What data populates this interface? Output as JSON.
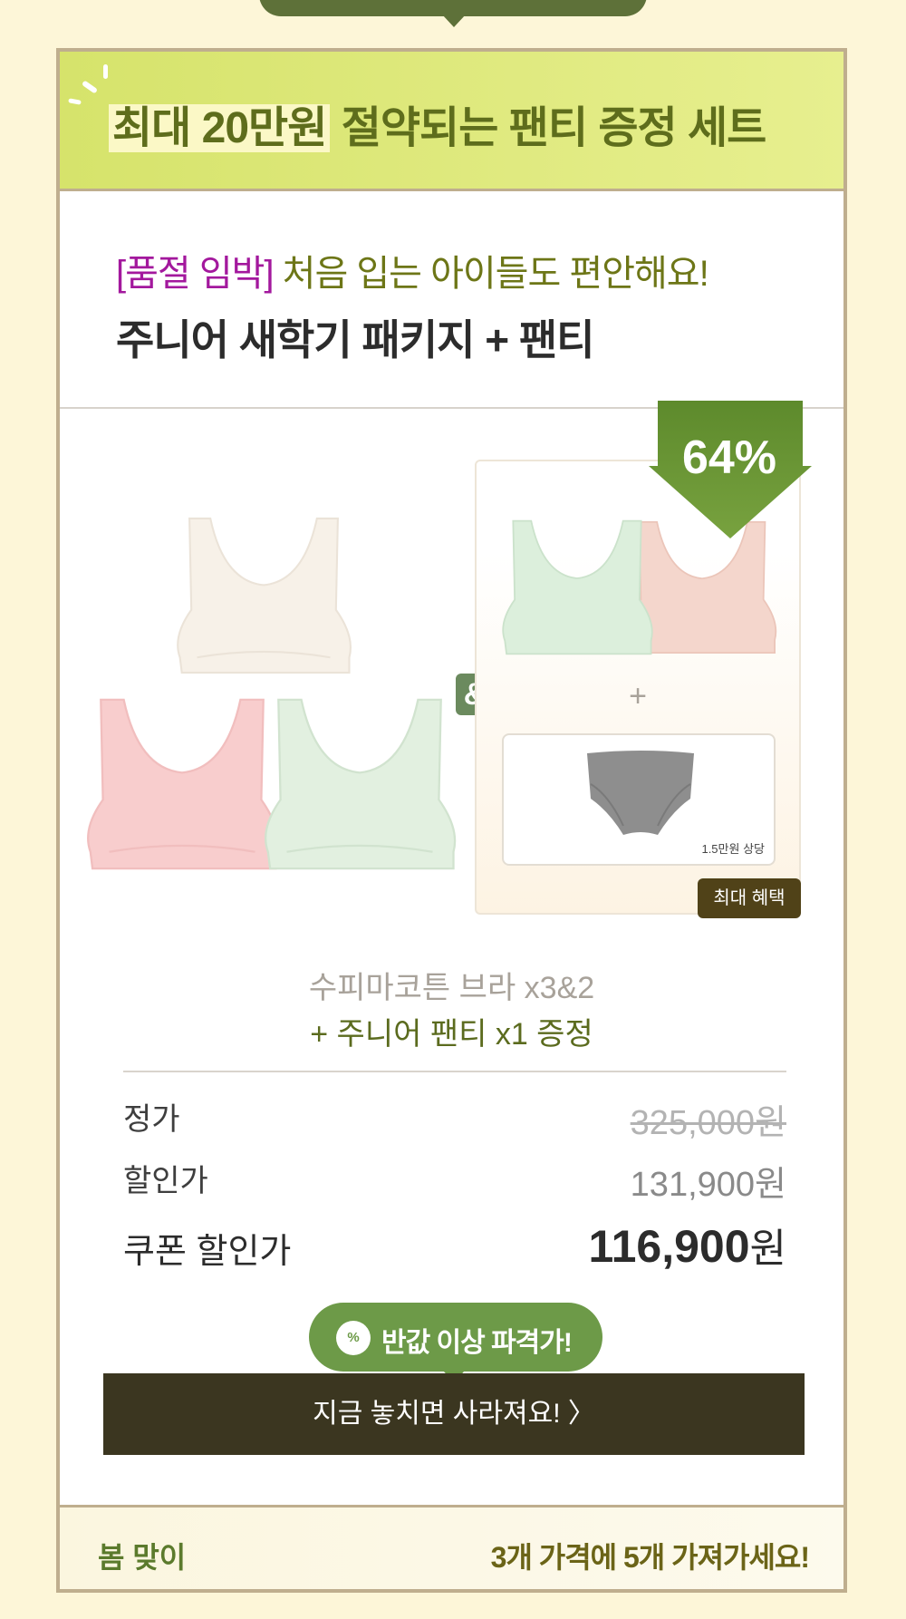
{
  "banner": {
    "highlight": "최대 20만원",
    "rest": " 절약되는 팬티 증정 세트"
  },
  "product": {
    "tag": "[품절 임박]",
    "subtitle": " 처음 입는 아이들도 편안해요!",
    "name": "주니어 새학기 패키지 + 팬티"
  },
  "visual": {
    "amp": "&",
    "plus": "+",
    "panty_note": "1.5만원 상당",
    "benefit_badge": "최대 혜택",
    "discount": "64%"
  },
  "bundle": {
    "line1": "수피마코튼 브라 x3&2",
    "line2": "+ 주니어 팬티 x1 증정"
  },
  "prices": {
    "regular_label": "정가",
    "regular_value": "325,000원",
    "sale_label": "할인가",
    "sale_value": "131,900원",
    "coupon_label": "쿠폰 할인가",
    "coupon_number": "116,900",
    "coupon_unit": "원"
  },
  "promo": {
    "icon": "%",
    "text": "반값 이상 파격가!"
  },
  "cta": {
    "label": "지금 놓치면 사라져요! 〉"
  },
  "footer": {
    "left": "봄 맞이",
    "right": "3개 가격에 5개 가져가세요!"
  },
  "colors": {
    "page_bg": "#fdf6d8",
    "accent_green": "#6d9a48",
    "dark_olive": "#3b3620",
    "tag_magenta": "#a3189d"
  }
}
